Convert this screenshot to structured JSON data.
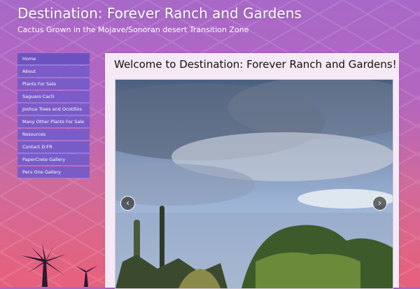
{
  "site": {
    "title": "Destination: Forever Ranch and Gardens",
    "tagline": "Cactus Grown in the Mojave/Sonoran desert Transition Zone"
  },
  "nav": {
    "items": [
      {
        "label": "Home"
      },
      {
        "label": "About"
      },
      {
        "label": "Plants For Sale"
      },
      {
        "label": "Saguaro Cacti"
      },
      {
        "label": "Joshua Trees and Ocotillos"
      },
      {
        "label": "Many Other Plants For Sale"
      },
      {
        "label": "Resources"
      },
      {
        "label": "Contact D:FR"
      },
      {
        "label": "PaperCrete Gallery"
      },
      {
        "label": "Peru One Gallery"
      }
    ]
  },
  "main": {
    "heading": "Welcome to Destination: Forever Ranch and Gardens!",
    "slideshow": {
      "prev_icon": "chevron-left-icon",
      "next_icon": "chevron-right-icon"
    }
  },
  "colors": {
    "nav_bg": "#7a5cc8",
    "content_bg": "#f4e9f4",
    "bg_top": "#a868c8",
    "bg_bottom": "#e8607a"
  }
}
